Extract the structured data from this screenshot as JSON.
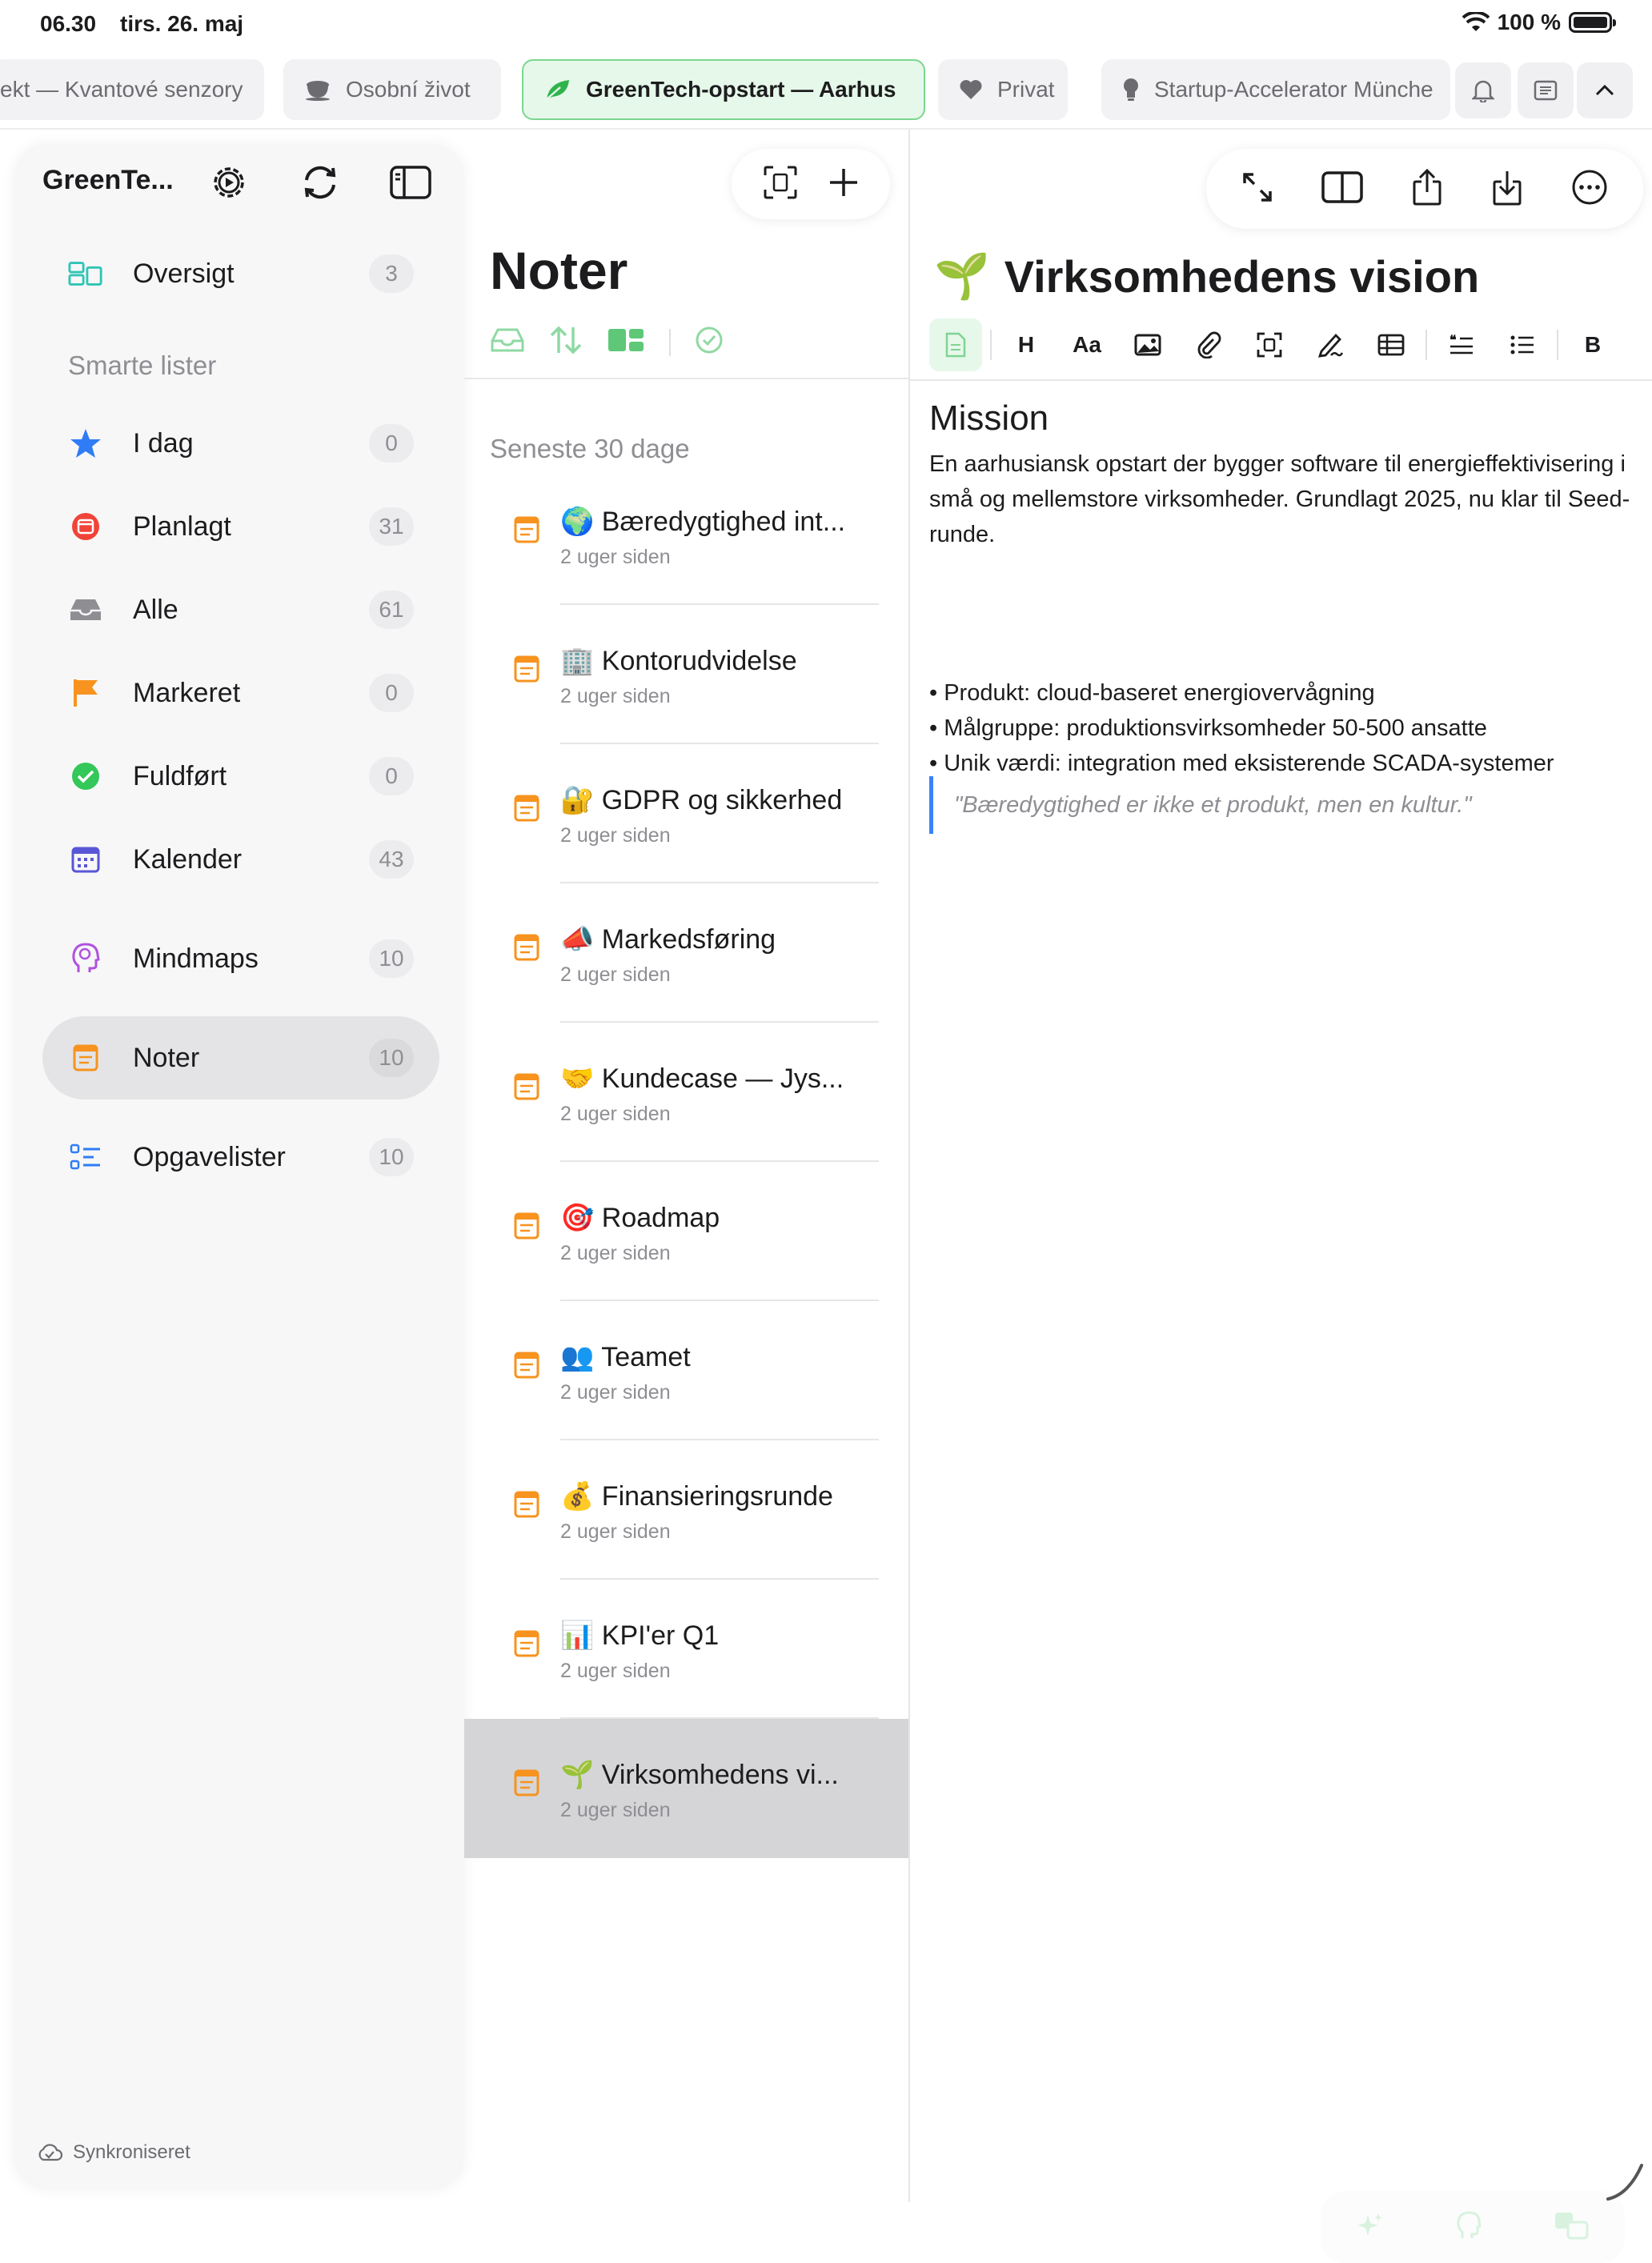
{
  "status": {
    "time": "06.30",
    "date": "tirs. 26. maj",
    "battery": "100 %"
  },
  "tabs": [
    {
      "label": "ekt — Kvantové senzory",
      "icon": "project-icon"
    },
    {
      "label": "Osobní život",
      "icon": "coffee-cup-icon"
    },
    {
      "label": "GreenTech-opstart — Aarhus",
      "icon": "leaf-icon"
    },
    {
      "label": "Privat",
      "icon": "heart-icon"
    },
    {
      "label": "Startup-Accelerator Münche",
      "icon": "lightbulb-icon"
    }
  ],
  "sidebar": {
    "title": "GreenTe...",
    "section_label": "Smarte lister",
    "items": [
      {
        "label": "Oversigt",
        "count": "3",
        "icon": "overview-icon",
        "color": "#30c4b5"
      },
      {
        "label": "I dag",
        "count": "0",
        "icon": "star-icon",
        "color": "#2f7cf6"
      },
      {
        "label": "Planlagt",
        "count": "31",
        "icon": "calendar-clock-icon",
        "color": "#f04438"
      },
      {
        "label": "Alle",
        "count": "61",
        "icon": "tray-icon",
        "color": "#8e8e93"
      },
      {
        "label": "Markeret",
        "count": "0",
        "icon": "flag-icon",
        "color": "#f7931e"
      },
      {
        "label": "Fuldført",
        "count": "0",
        "icon": "checkmark-circle-icon",
        "color": "#34c759"
      },
      {
        "label": "Kalender",
        "count": "43",
        "icon": "calendar-icon",
        "color": "#5856d6"
      },
      {
        "label": "Mindmaps",
        "count": "10",
        "icon": "mindmap-head-icon",
        "color": "#af52de"
      },
      {
        "label": "Noter",
        "count": "10",
        "icon": "note-icon",
        "color": "#f7931e"
      },
      {
        "label": "Opgavelister",
        "count": "10",
        "icon": "checklist-icon",
        "color": "#2f7cf6"
      }
    ],
    "footer": "Synkroniseret"
  },
  "list": {
    "title": "Noter",
    "section": "Seneste 30 dage",
    "notes": [
      {
        "emoji": "🌍",
        "title": "Bæredygtighed int...",
        "date": "2 uger siden"
      },
      {
        "emoji": "🏢",
        "title": "Kontorudvidelse",
        "date": "2 uger siden"
      },
      {
        "emoji": "🔐",
        "title": "GDPR og sikkerhed",
        "date": "2 uger siden"
      },
      {
        "emoji": "📣",
        "title": "Markedsføring",
        "date": "2 uger siden"
      },
      {
        "emoji": "🤝",
        "title": "Kundecase — Jys...",
        "date": "2 uger siden"
      },
      {
        "emoji": "🎯",
        "title": "Roadmap",
        "date": "2 uger siden"
      },
      {
        "emoji": "👥",
        "title": "Teamet",
        "date": "2 uger siden"
      },
      {
        "emoji": "💰",
        "title": "Finansieringsrunde",
        "date": "2 uger siden"
      },
      {
        "emoji": "📊",
        "title": "KPI'er Q1",
        "date": "2 uger siden"
      },
      {
        "emoji": "🌱",
        "title": "Virksomhedens vi...",
        "date": "2 uger siden"
      }
    ]
  },
  "editor": {
    "emoji": "🌱",
    "title": "Virksomhedens vision",
    "format_buttons": {
      "heading": "H",
      "font": "Aa",
      "bold": "B"
    },
    "heading": "Mission",
    "paragraph": "En aarhusiansk opstart der bygger software til energieffektivisering i små og mellemstore virksomheder. Grundlagt 2025, nu klar til Seed-runde.",
    "bullets": [
      "• Produkt: cloud-baseret energiovervågning",
      "• Målgruppe: produktionsvirksomheder 50-500 ansatte",
      "• Unik værdi: integration med eksisterende SCADA-systemer"
    ],
    "quote": "\"Bæredygtighed er ikke et produkt, men en kultur.\""
  },
  "colors": {
    "accent_green": "#34c759",
    "note_orange": "#f7931e",
    "quote_blue": "#3a82f7"
  }
}
